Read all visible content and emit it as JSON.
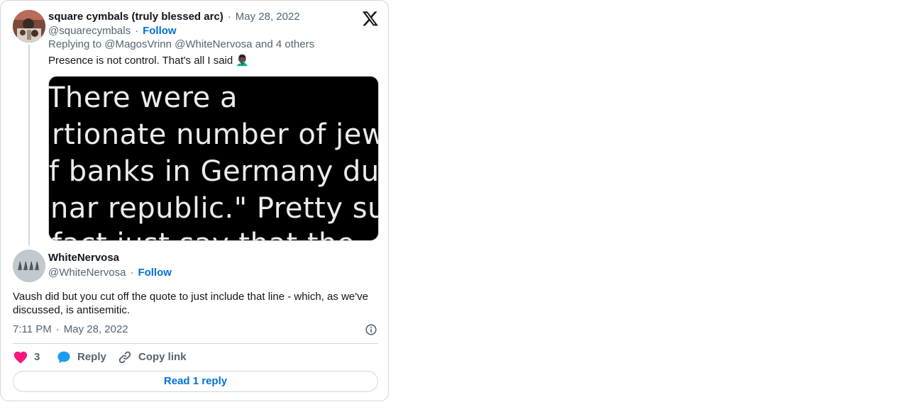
{
  "tweet_parent": {
    "display_name": "square cymbals (truly blessed arc)",
    "date": "May 28, 2022",
    "handle": "@squarecymbals",
    "follow_label": "Follow",
    "replying_prefix": "Replying to",
    "replying_to": "@MagosVrinn @WhiteNervosa",
    "replying_suffix": "and 4 others",
    "text": "Presence is not control. That's all I said",
    "emoji": "🤦🏿‍♂️",
    "image_lines": [
      "There were a",
      "rtionate number of jewish",
      "f banks in Germany during",
      "nar republic.\" Pretty sure",
      "fact just say that the"
    ]
  },
  "tweet_main": {
    "display_name": "WhiteNervosa",
    "handle": "@WhiteNervosa",
    "follow_label": "Follow",
    "text": "Vaush did but you cut off the quote to just include that line - which, as we've discussed, is antisemitic.",
    "time": "7:11 PM",
    "date": "May 28, 2022"
  },
  "actions": {
    "like_count": "3",
    "reply_label": "Reply",
    "copy_label": "Copy link"
  },
  "read_replies_label": "Read 1 reply",
  "colors": {
    "accent": "#006fd6",
    "like": "#f91880",
    "reply": "#1d9bf0",
    "muted": "#536471",
    "border": "#cfd9de"
  },
  "icons": [
    "x-logo-icon",
    "info-icon",
    "heart-icon",
    "reply-bubble-icon",
    "link-icon"
  ]
}
